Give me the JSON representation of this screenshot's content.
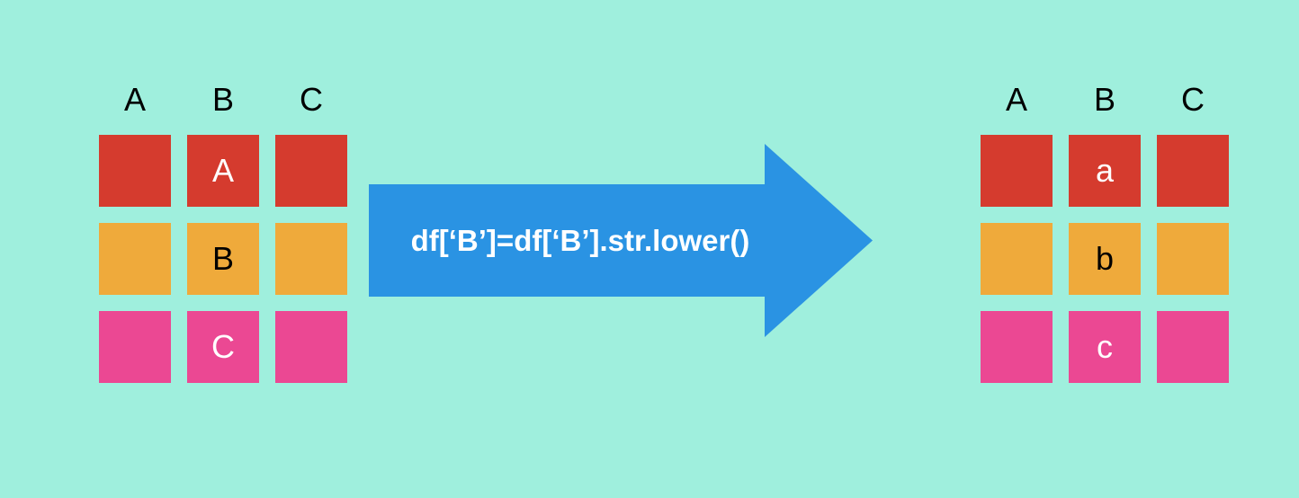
{
  "colors": {
    "red": "#D53B2E",
    "orange": "#EFAA3B",
    "pink": "#EB4893",
    "arrow": "#2A93E3"
  },
  "headers": [
    "A",
    "B",
    "C"
  ],
  "left_grid": {
    "rows": [
      {
        "color": "red",
        "b_value": "A",
        "b_text_color": "white"
      },
      {
        "color": "orange",
        "b_value": "B",
        "b_text_color": "black"
      },
      {
        "color": "pink",
        "b_value": "C",
        "b_text_color": "white"
      }
    ]
  },
  "right_grid": {
    "rows": [
      {
        "color": "red",
        "b_value": "a",
        "b_text_color": "white"
      },
      {
        "color": "orange",
        "b_value": "b",
        "b_text_color": "black"
      },
      {
        "color": "pink",
        "b_value": "c",
        "b_text_color": "white"
      }
    ]
  },
  "arrow_label": "df[‘B’]=df[‘B’].str.lower()"
}
